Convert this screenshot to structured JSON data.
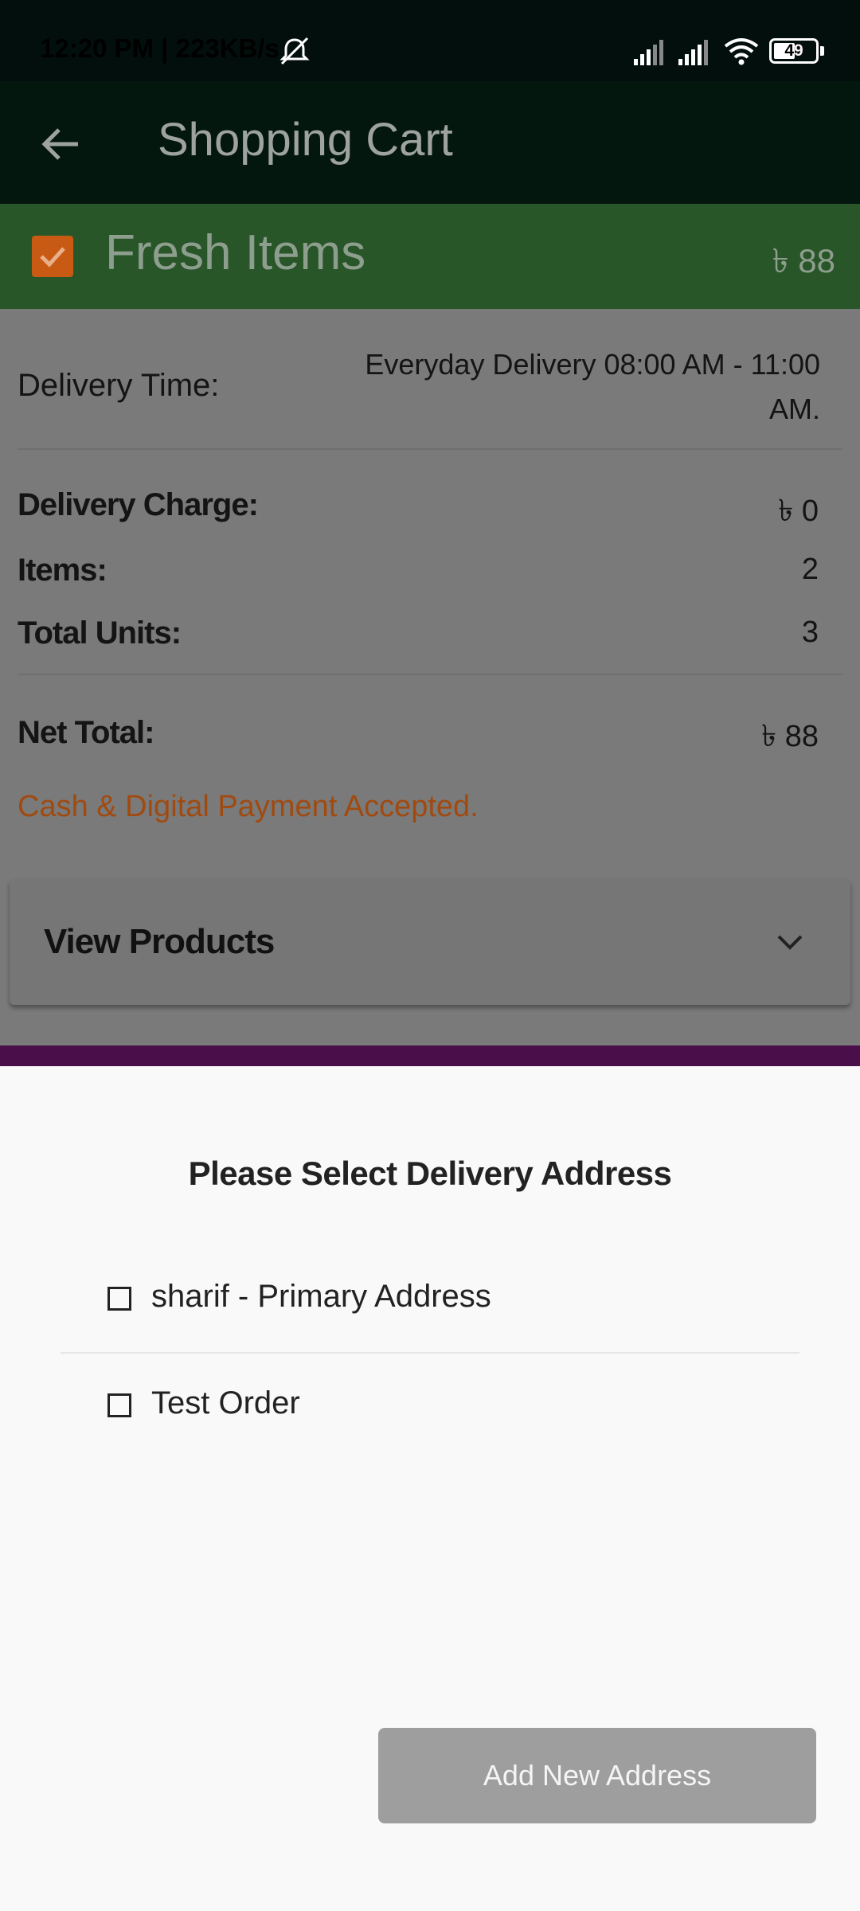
{
  "status_bar": {
    "time_speed": "12:20 PM | 223KB/s",
    "battery": "49",
    "icons": [
      "mute-bell-icon",
      "signal-icon",
      "signal-icon",
      "wifi-icon",
      "battery-icon"
    ]
  },
  "app_bar": {
    "title": "Shopping Cart",
    "back_icon": "arrow-left-icon"
  },
  "store": {
    "name": "Fresh Items",
    "price": "৳ 88",
    "checked": true
  },
  "details": {
    "delivery_time_label": "Delivery Time:",
    "delivery_time_value": "Everyday Delivery 08:00 AM - 11:00 AM.",
    "delivery_charge_label": "Delivery Charge:",
    "delivery_charge_value": "৳ 0",
    "items_label": "Items:",
    "items_value": "2",
    "total_units_label": "Total Units:",
    "total_units_value": "3",
    "net_total_label": "Net Total:",
    "net_total_value": "৳ 88",
    "payment_note": "Cash & Digital Payment Accepted."
  },
  "view_products": {
    "label": "View Products",
    "icon": "chevron-down-icon"
  },
  "address_sheet": {
    "title": "Please Select Delivery Address",
    "options": [
      {
        "label": "sharif - Primary Address",
        "checked": false
      },
      {
        "label": "Test Order",
        "checked": false
      }
    ],
    "add_button": "Add New Address"
  },
  "colors": {
    "status_bar": "#030f0d",
    "app_bar": "#03170f",
    "store_bar": "#285628",
    "accent_orange": "#c95a14",
    "scrim_bg": "#7a7a7a",
    "purple_strip": "#4a0f4b",
    "sheet_bg": "#f9f9f9",
    "button_disabled": "#9e9e9e"
  }
}
